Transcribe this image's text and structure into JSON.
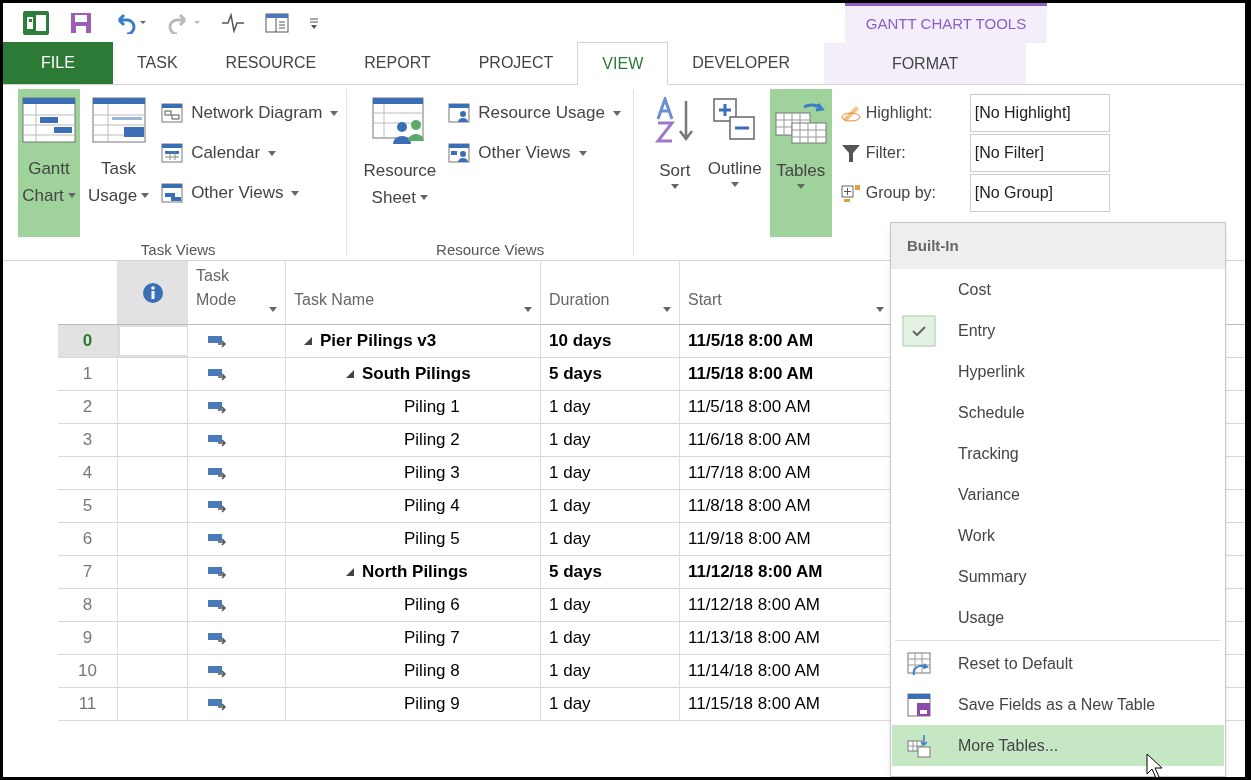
{
  "tabs": [
    {
      "label": "FILE",
      "kind": "file"
    },
    {
      "label": "TASK",
      "kind": "tab",
      "selected": false
    },
    {
      "label": "RESOURCE",
      "kind": "tab",
      "selected": false
    },
    {
      "label": "REPORT",
      "kind": "tab",
      "selected": false
    },
    {
      "label": "PROJECT",
      "kind": "tab",
      "selected": false
    },
    {
      "label": "VIEW",
      "kind": "tab",
      "selected": true
    },
    {
      "label": "DEVELOPER",
      "kind": "tab",
      "selected": false
    }
  ],
  "contextual": {
    "title": "GANTT CHART TOOLS",
    "tabs": [
      {
        "label": "FORMAT",
        "selected": false
      }
    ]
  },
  "ribbon": {
    "task_views": {
      "label": "Task Views",
      "big": [
        {
          "lines": [
            "Gantt",
            "Chart"
          ],
          "kind": "gantt",
          "active": true
        },
        {
          "lines": [
            "Task",
            "Usage"
          ],
          "kind": "usage",
          "active": false
        }
      ],
      "small": [
        {
          "label": "Network Diagram",
          "kind": "network"
        },
        {
          "label": "Calendar",
          "kind": "calendar"
        },
        {
          "label": "Other Views",
          "kind": "other"
        }
      ]
    },
    "resource_views": {
      "label": "Resource Views",
      "big": [
        {
          "lines": [
            "Resource",
            "Sheet"
          ],
          "kind": "resource",
          "active": false
        }
      ],
      "small": [
        {
          "label": "Resource Usage",
          "kind": "resusage"
        },
        {
          "label": "Other Views",
          "kind": "resother"
        }
      ]
    },
    "data": {
      "big": [
        {
          "lines": [
            "Sort"
          ],
          "kind": "sort",
          "active": false
        },
        {
          "lines": [
            "Outline"
          ],
          "kind": "outline",
          "active": false
        },
        {
          "lines": [
            "Tables"
          ],
          "kind": "tables",
          "active": true
        }
      ],
      "fields": [
        {
          "label": "Highlight:",
          "kind": "highlight",
          "value": "[No Highlight]"
        },
        {
          "label": "Filter:",
          "kind": "filter",
          "value": "[No Filter]"
        },
        {
          "label": "Group by:",
          "kind": "group",
          "value": "[No Group]"
        }
      ]
    }
  },
  "grid": {
    "columns": [
      {
        "label": "Task Mode",
        "kind": "mode"
      },
      {
        "label": "Task Name",
        "kind": "name"
      },
      {
        "label": "Duration",
        "kind": "duration"
      },
      {
        "label": "Start",
        "kind": "start"
      }
    ],
    "tasks": [
      {
        "id": "0",
        "name": "Pier Pilings v3",
        "duration": "10 days",
        "start": "11/5/18 8:00 AM",
        "selected": true,
        "expanded": true,
        "children": [
          {
            "id": "1",
            "name": "South Pilings",
            "duration": "5 days",
            "start": "11/5/18 8:00 AM",
            "selected": false,
            "expanded": true,
            "children": [
              {
                "id": "2",
                "name": "Piling 1",
                "duration": "1 day",
                "start": "11/5/18 8:00 AM",
                "selected": false
              },
              {
                "id": "3",
                "name": "Piling 2",
                "duration": "1 day",
                "start": "11/6/18 8:00 AM",
                "selected": false
              },
              {
                "id": "4",
                "name": "Piling 3",
                "duration": "1 day",
                "start": "11/7/18 8:00 AM",
                "selected": false
              },
              {
                "id": "5",
                "name": "Piling 4",
                "duration": "1 day",
                "start": "11/8/18 8:00 AM",
                "selected": false
              },
              {
                "id": "6",
                "name": "Piling 5",
                "duration": "1 day",
                "start": "11/9/18 8:00 AM",
                "selected": false
              }
            ]
          },
          {
            "id": "7",
            "name": "North Pilings",
            "duration": "5 days",
            "start": "11/12/18 8:00 AM",
            "selected": false,
            "expanded": true,
            "children": [
              {
                "id": "8",
                "name": "Piling 6",
                "duration": "1 day",
                "start": "11/12/18 8:00 AM",
                "selected": false
              },
              {
                "id": "9",
                "name": "Piling 7",
                "duration": "1 day",
                "start": "11/13/18 8:00 AM",
                "selected": false
              },
              {
                "id": "10",
                "name": "Piling 8",
                "duration": "1 day",
                "start": "11/14/18 8:00 AM",
                "selected": false
              },
              {
                "id": "11",
                "name": "Piling 9",
                "duration": "1 day",
                "start": "11/15/18 8:00 AM",
                "selected": false
              }
            ]
          }
        ]
      }
    ]
  },
  "menu": {
    "header": "Built-In",
    "items": [
      {
        "label": "Cost",
        "kind": "table",
        "checked": false,
        "selected": false
      },
      {
        "label": "Entry",
        "kind": "table",
        "checked": true,
        "selected": false
      },
      {
        "label": "Hyperlink",
        "kind": "table",
        "checked": false,
        "selected": false
      },
      {
        "label": "Schedule",
        "kind": "table",
        "checked": false,
        "selected": false
      },
      {
        "label": "Tracking",
        "kind": "table",
        "checked": false,
        "selected": false
      },
      {
        "label": "Variance",
        "kind": "table",
        "checked": false,
        "selected": false
      },
      {
        "label": "Work",
        "kind": "table",
        "checked": false,
        "selected": false
      },
      {
        "label": "Summary",
        "kind": "table",
        "checked": false,
        "selected": false
      },
      {
        "label": "Usage",
        "kind": "table",
        "checked": false,
        "selected": false
      },
      {
        "label": "Reset to Default",
        "kind": "reset",
        "selected": false
      },
      {
        "label": "Save Fields as a New Table",
        "kind": "save",
        "selected": false
      },
      {
        "label": "More Tables...",
        "kind": "more",
        "selected": true
      }
    ]
  }
}
